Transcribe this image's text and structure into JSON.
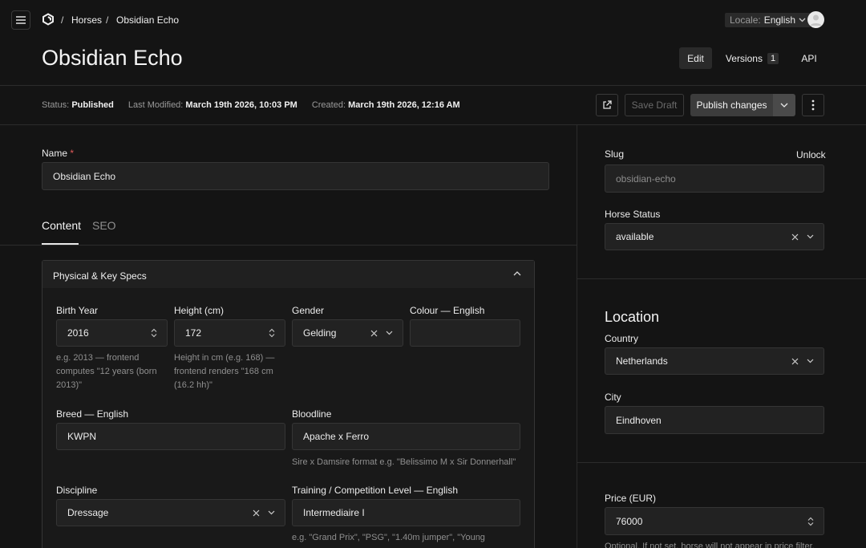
{
  "nav": {
    "crumb_sep": "/",
    "breadcrumb_collection": "Horses",
    "breadcrumb_doc": "Obsidian Echo",
    "locale_label": "Locale:",
    "locale_value": "English"
  },
  "header": {
    "title": "Obsidian Echo",
    "edit_label": "Edit",
    "versions_label": "Versions",
    "versions_count": "1",
    "api_label": "API"
  },
  "status": {
    "status_label": "Status:",
    "status_value": "Published",
    "modified_label": "Last Modified:",
    "modified_value": "March 19th 2026, 10:03 PM",
    "created_label": "Created:",
    "created_value": "March 19th 2026, 12:16 AM",
    "save_draft_label": "Save Draft",
    "publish_label": "Publish changes"
  },
  "main": {
    "name_label": "Name",
    "required_mark": "*",
    "name_value": "Obsidian Echo",
    "tabs": [
      {
        "label": "Content"
      },
      {
        "label": "SEO"
      }
    ],
    "group_title": "Physical & Key Specs",
    "fields": {
      "birth_year": {
        "label": "Birth Year",
        "value": "2016",
        "help": "e.g. 2013 — frontend computes \"12 years (born 2013)\""
      },
      "height": {
        "label": "Height (cm)",
        "value": "172",
        "help": "Height in cm (e.g. 168) — frontend renders \"168 cm (16.2 hh)\""
      },
      "gender": {
        "label": "Gender",
        "value": "Gelding"
      },
      "colour": {
        "label": "Colour — English",
        "value": ""
      },
      "breed": {
        "label": "Breed — English",
        "value": "KWPN"
      },
      "bloodline": {
        "label": "Bloodline",
        "value": "Apache x Ferro",
        "help": "Sire x Damsire format e.g. \"Belissimo M x Sir Donnerhall\""
      },
      "discipline": {
        "label": "Discipline",
        "value": "Dressage"
      },
      "training": {
        "label": "Training / Competition Level — English",
        "value": "Intermediaire I",
        "help": "e.g. \"Grand Prix\", \"PSG\", \"1.40m jumper\", \"Young"
      }
    }
  },
  "sidebar": {
    "slug_label": "Slug",
    "unlock_label": "Unlock",
    "slug_value": "obsidian-echo",
    "horse_status_label": "Horse Status",
    "horse_status_value": "available",
    "location_title": "Location",
    "country_label": "Country",
    "country_value": "Netherlands",
    "city_label": "City",
    "city_value": "Eindhoven",
    "price_label": "Price (EUR)",
    "price_value": "76000",
    "price_help": "Optional. If not set, horse will not appear in price filter."
  }
}
